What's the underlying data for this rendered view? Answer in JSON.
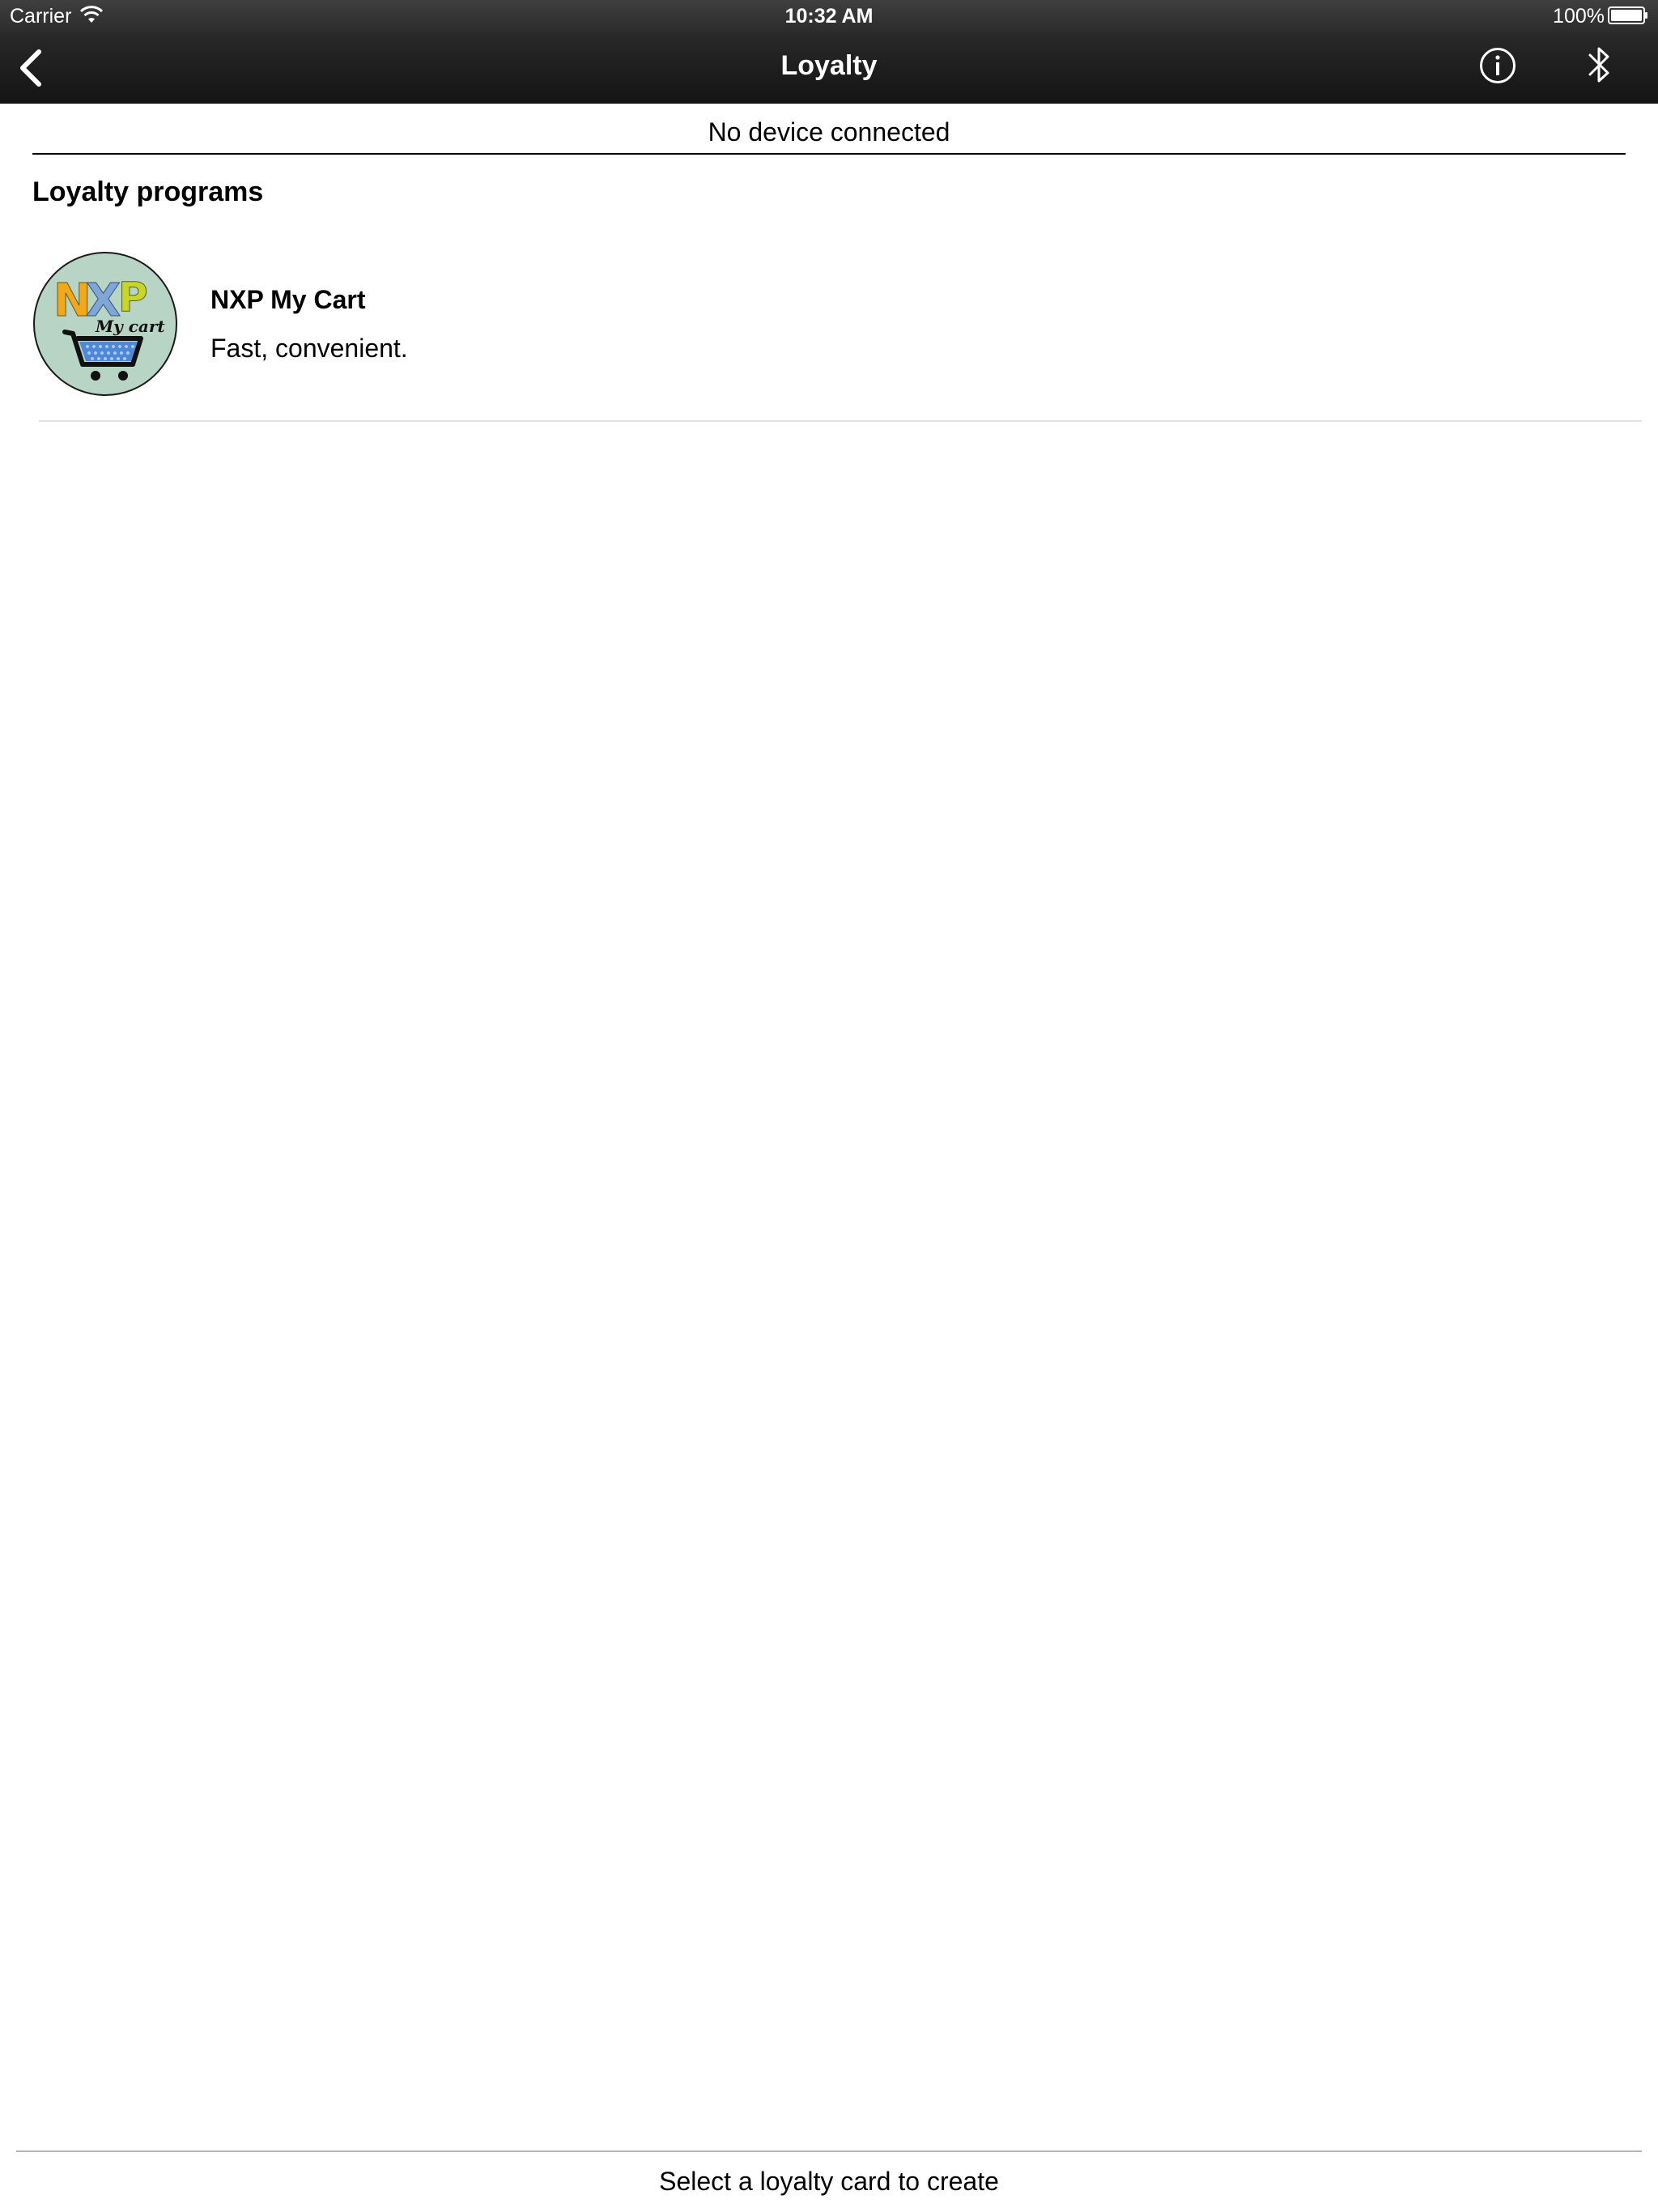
{
  "status_bar": {
    "carrier": "Carrier",
    "time": "10:32 AM",
    "battery": "100%"
  },
  "nav": {
    "title": "Loyalty",
    "back_icon": "chevron-left-icon",
    "info_icon": "info-icon",
    "bluetooth_icon": "bluetooth-icon"
  },
  "connection": {
    "status": "No device connected"
  },
  "section": {
    "title": "Loyalty programs"
  },
  "programs": [
    {
      "name": "NXP My Cart",
      "description": "Fast, convenient.",
      "logo": {
        "brand_text": "NXP",
        "tagline": "My cart",
        "icon": "shopping-cart-icon"
      }
    }
  ],
  "footer": {
    "hint": "Select a loyalty card to create"
  },
  "colors": {
    "nav_background": "#1f1f1f",
    "logo_background": "#b8d4c4",
    "logo_n": "#f2a81d",
    "logo_x": "#7fa6d6",
    "logo_p": "#c8d62b",
    "cart_basket": "#4f88d6"
  }
}
